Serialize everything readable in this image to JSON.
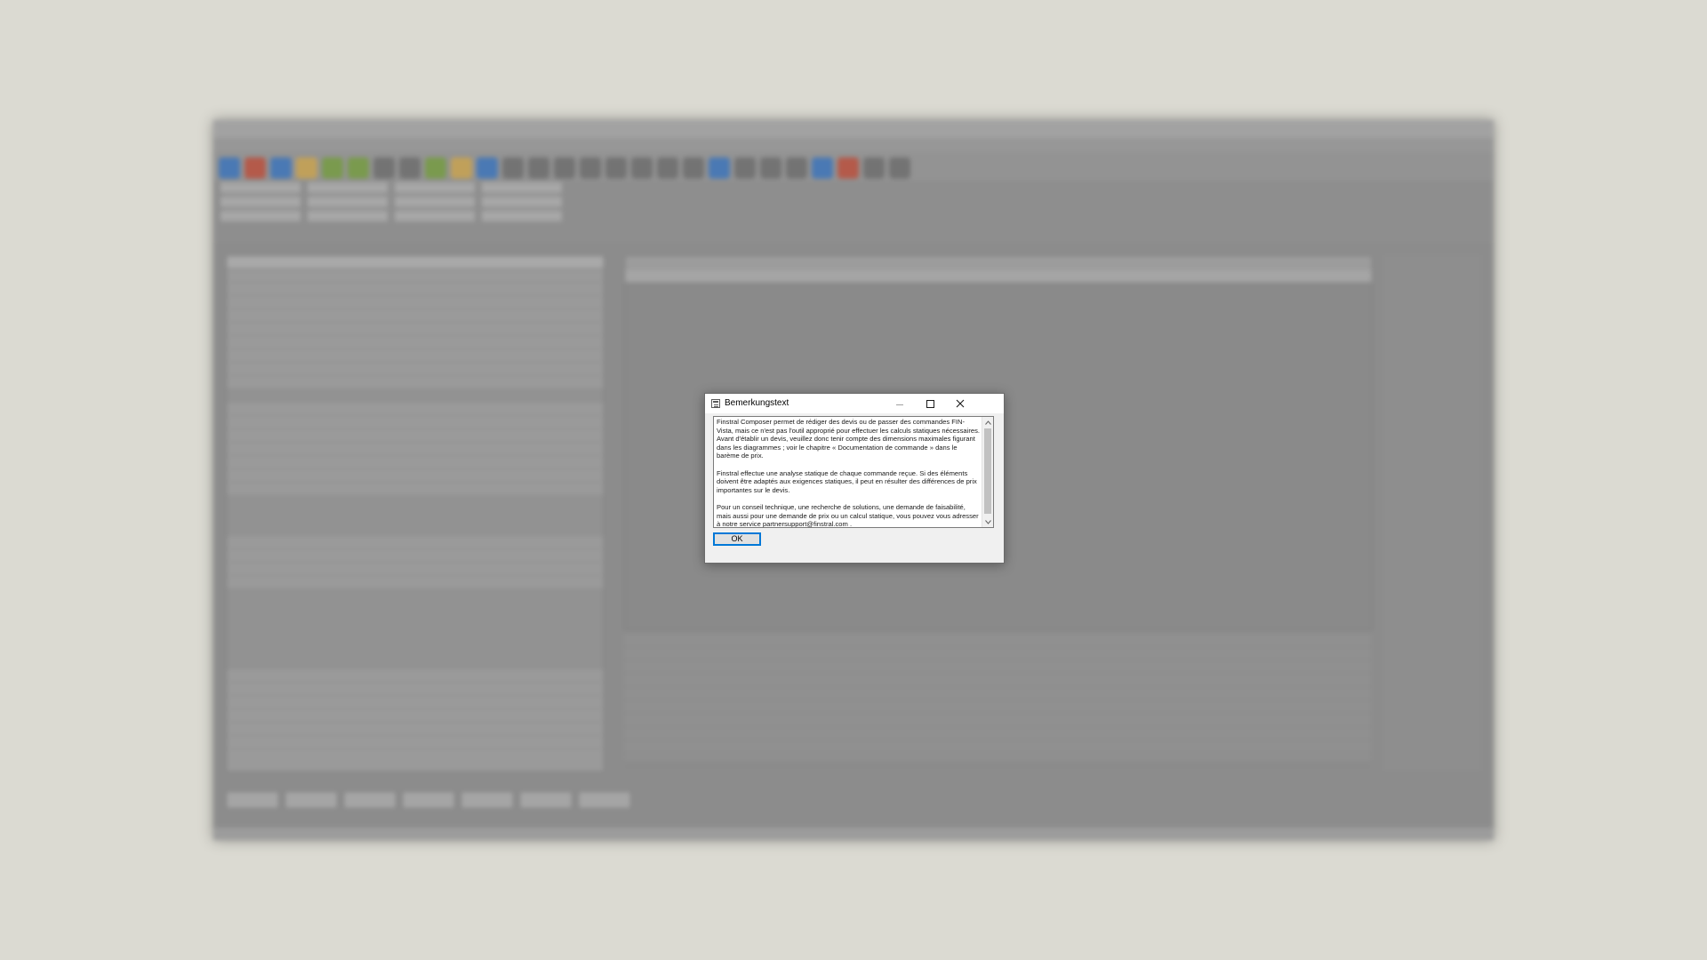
{
  "dialog": {
    "title": "Bemerkungstext",
    "paragraphs": [
      "Finstral Composer permet de rédiger des devis ou de passer des commandes FIN-Vista, mais ce n'est pas l'outil approprié pour effectuer les calculs statiques nécessaires. Avant d'établir un devis, veuillez donc tenir compte des dimensions maximales figurant dans les diagrammes ; voir le chapitre « Documentation de commande » dans le barème de prix.",
      "Finstral effectue une analyse statique de chaque commande reçue. Si des éléments doivent être adaptés aux exigences statiques, il peut en résulter des différences de prix importantes sur le devis.",
      "Pour un conseil technique, une recherche de solutions, une demande de faisabilité, mais aussi pour une demande de prix ou un calcul statique, vous pouvez vous adresser à notre service partnersupport@finstral.com ."
    ],
    "ok_label": "OK",
    "icons": {
      "window": "document-icon",
      "minimize": "minimize-icon",
      "maximize": "maximize-icon",
      "close": "close-icon",
      "scroll_up": "chevron-up-icon",
      "scroll_down": "chevron-down-icon"
    },
    "colors": {
      "focus_border": "#0078d7",
      "dialog_background": "#f0f0f0"
    }
  }
}
